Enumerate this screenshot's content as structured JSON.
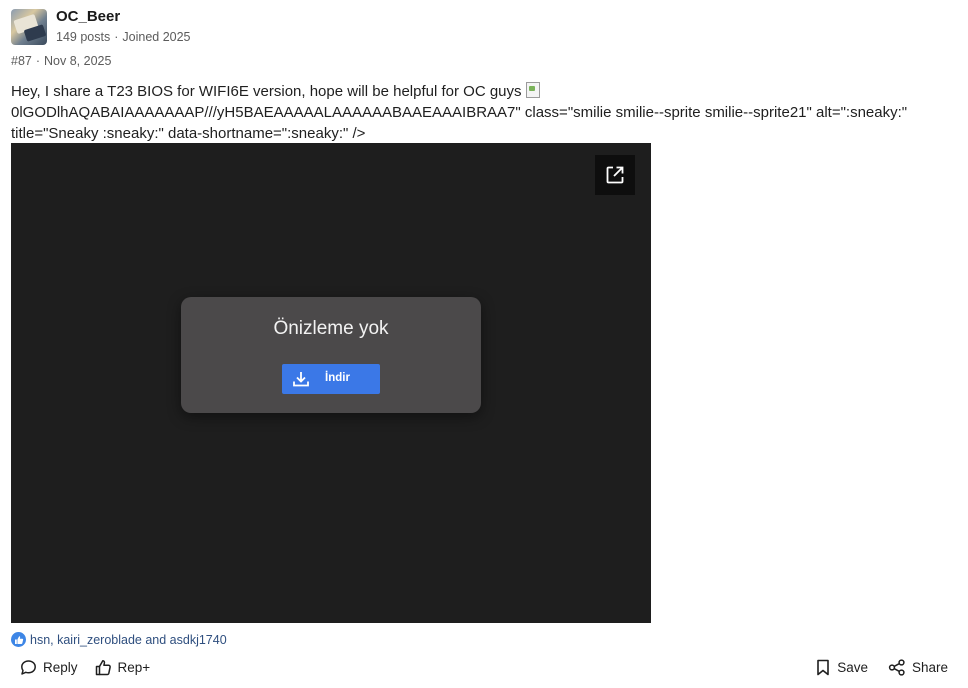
{
  "post": {
    "username": "OC_Beer",
    "posts": "149 posts",
    "joined": "Joined 2025",
    "number": "#87",
    "date": "Nov 8, 2025",
    "text_line1": "Hey, I share a T23 BIOS for WIFI6E version, hope will be helpful for OC guys",
    "text_line2": "0lGODlhAQABAIAAAAAAAP///yH5BAEAAAAALAAAAAABAAEAAAIBRAA7\" class=\"smilie smilie--sprite smilie--sprite21\" alt=\":sneaky:\"",
    "text_line3": "title=\"Sneaky :sneaky:\" data-shortname=\":sneaky:\" />"
  },
  "viewer": {
    "no_preview": "Önizleme yok",
    "download_label": "İndir",
    "open_icon": "open-in-new-icon",
    "background": "#1e1e1e",
    "dialog_color": "#4b494a",
    "button_color": "#3b78e7"
  },
  "reactions": {
    "users": "hsn, kairi_zeroblade and asdkj1740",
    "icon": "like-icon",
    "color": "#3d86e6"
  },
  "actions": {
    "reply": "Reply",
    "rep": "Rep+",
    "save": "Save",
    "share": "Share"
  }
}
